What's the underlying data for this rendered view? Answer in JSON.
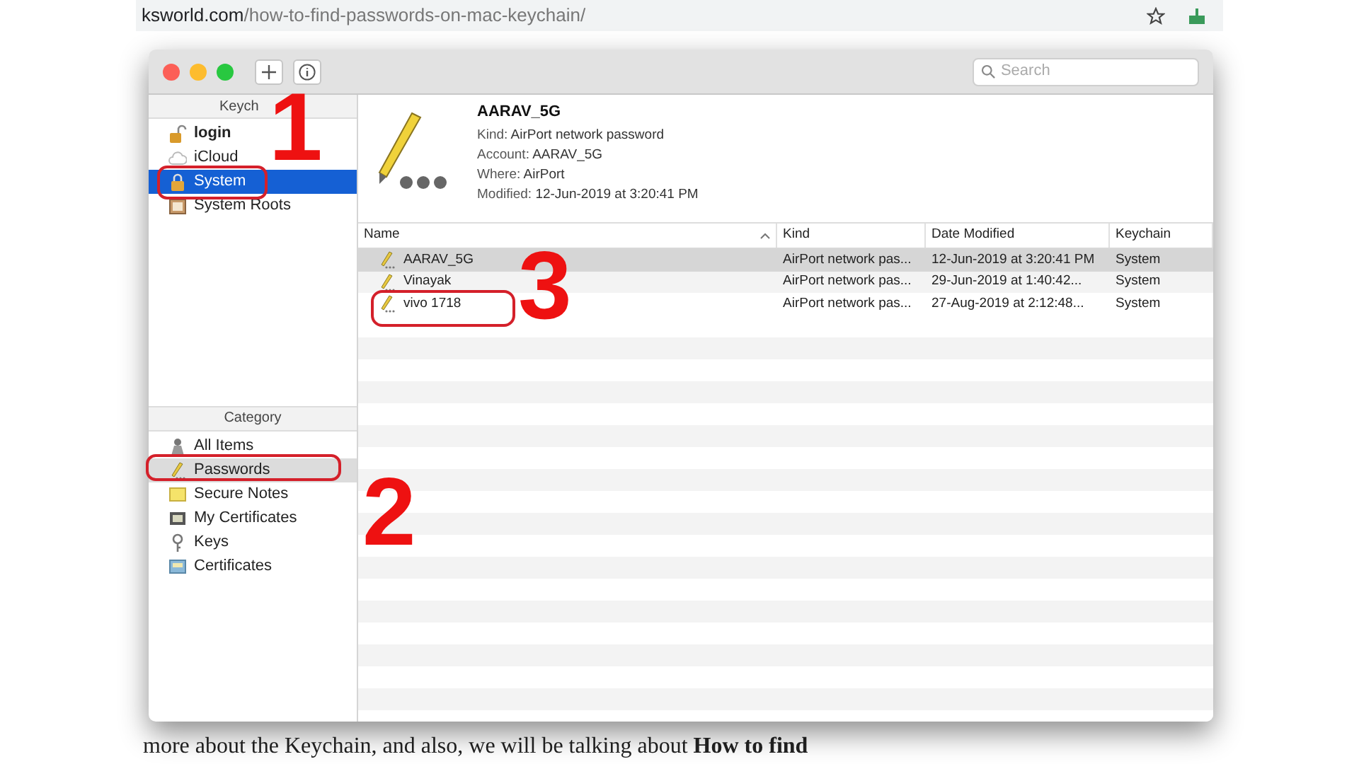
{
  "browser": {
    "url_host": "ksworld.com",
    "url_path": "/how-to-find-passwords-on-mac-keychain/"
  },
  "article": {
    "text": "more about the Keychain, and also, we will be talking about **How to find**"
  },
  "window": {
    "search": {
      "placeholder": "Search"
    },
    "keychains_header": "Keych",
    "keychains": [
      {
        "label": "login",
        "kind": "unlocked",
        "default": true,
        "selected": false
      },
      {
        "label": "iCloud",
        "kind": "cloud",
        "default": false,
        "selected": false
      },
      {
        "label": "System",
        "kind": "locked",
        "default": false,
        "selected": true
      },
      {
        "label": "System Roots",
        "kind": "cabinet",
        "default": false,
        "selected": false
      }
    ],
    "category_header": "Category",
    "categories": [
      {
        "label": "All Items",
        "kind": "all",
        "selected": false
      },
      {
        "label": "Passwords",
        "kind": "password",
        "selected": true
      },
      {
        "label": "Secure Notes",
        "kind": "note",
        "selected": false
      },
      {
        "label": "My Certificates",
        "kind": "mycert",
        "selected": false
      },
      {
        "label": "Keys",
        "kind": "key",
        "selected": false
      },
      {
        "label": "Certificates",
        "kind": "cert",
        "selected": false
      }
    ],
    "detail": {
      "title": "AARAV_5G",
      "fields": [
        {
          "label": "Kind:",
          "value": "AirPort network password"
        },
        {
          "label": "Account:",
          "value": "AARAV_5G"
        },
        {
          "label": "Where:",
          "value": "AirPort"
        },
        {
          "label": "Modified:",
          "value": "12-Jun-2019 at 3:20:41 PM"
        }
      ]
    },
    "table": {
      "columns": [
        "Name",
        "Kind",
        "Date Modified",
        "Keychain"
      ],
      "rows": [
        {
          "name": "AARAV_5G",
          "kind": "AirPort network pas...",
          "date": "12-Jun-2019 at 3:20:41 PM",
          "keychain": "System",
          "selected": true
        },
        {
          "name": "Vinayak",
          "kind": "AirPort network pas...",
          "date": "29-Jun-2019 at 1:40:42...",
          "keychain": "System",
          "selected": false
        },
        {
          "name": "vivo 1718",
          "kind": "AirPort network pas...",
          "date": "27-Aug-2019 at 2:12:48...",
          "keychain": "System",
          "selected": false
        }
      ]
    }
  },
  "annotations": [
    {
      "label": "1"
    },
    {
      "label": "2"
    },
    {
      "label": "3"
    }
  ]
}
